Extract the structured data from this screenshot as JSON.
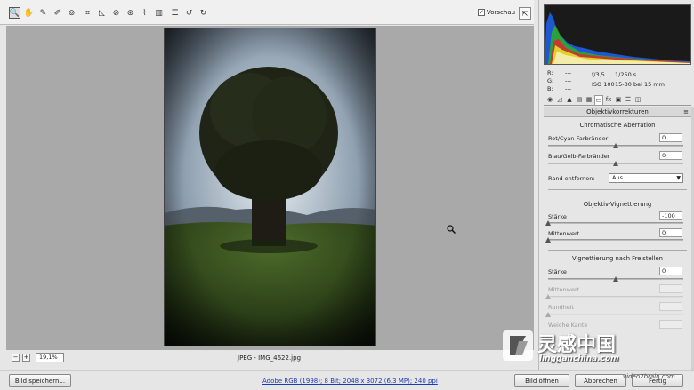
{
  "toolbar": {
    "tools": [
      {
        "name": "zoom-tool",
        "icon": "magnifier-icon",
        "glyph": "🔍"
      },
      {
        "name": "hand-tool",
        "icon": "hand-icon",
        "glyph": "✋"
      },
      {
        "name": "white-balance-tool",
        "icon": "eyedropper-icon",
        "glyph": "✎"
      },
      {
        "name": "color-sampler-tool",
        "icon": "eyedropper-plus-icon",
        "glyph": "✐"
      },
      {
        "name": "targeted-adjustment-tool",
        "icon": "target-icon",
        "glyph": "⊚"
      },
      {
        "name": "crop-tool",
        "icon": "crop-icon",
        "glyph": "⌗"
      },
      {
        "name": "straighten-tool",
        "icon": "straighten-icon",
        "glyph": "◺"
      },
      {
        "name": "spot-removal-tool",
        "icon": "spot-icon",
        "glyph": "⊘"
      },
      {
        "name": "red-eye-tool",
        "icon": "red-eye-icon",
        "glyph": "⊛"
      },
      {
        "name": "adjustment-brush-tool",
        "icon": "brush-icon",
        "glyph": "⌇"
      },
      {
        "name": "graduated-filter-tool",
        "icon": "gradient-icon",
        "glyph": "▥"
      },
      {
        "name": "preferences-button",
        "icon": "list-icon",
        "glyph": "☰"
      },
      {
        "name": "rotate-left-button",
        "icon": "rotate-left-icon",
        "glyph": "↺"
      },
      {
        "name": "rotate-right-button",
        "icon": "rotate-right-icon",
        "glyph": "↻"
      }
    ],
    "preview_label": "Vorschau",
    "preview_checked": true
  },
  "canvas": {
    "filename": "JPEG - IMG_4622.jpg",
    "zoom_level": "19,1%"
  },
  "footer": {
    "save_label": "Bild speichern...",
    "workflow_link": "Adobe RGB (1998); 8 Bit; 2048 x 3072 (6,3 MP); 240 ppi",
    "open_label": "Bild öffnen",
    "cancel_label": "Abbrechen",
    "done_label": "Fertig"
  },
  "camera_info": {
    "r_label": "R:",
    "r_value": "---",
    "g_label": "G:",
    "g_value": "---",
    "b_label": "B:",
    "b_value": "---",
    "aperture": "f/3,5",
    "shutter": "1/250 s",
    "iso": "ISO 100",
    "lens": "15-30 bei 15 mm"
  },
  "panel": {
    "title": "Objektivkorrekturen",
    "chromatic_title": "Chromatische Aberration",
    "red_cyan_label": "Rot/Cyan-Farbränder",
    "red_cyan_value": "0",
    "blue_yellow_label": "Blau/Gelb-Farbränder",
    "blue_yellow_value": "0",
    "defringe_label": "Rand entfernen:",
    "defringe_value": "Aus",
    "lens_vignette_title": "Objektiv-Vignettierung",
    "amount_label": "Stärke",
    "amount_value": "-100",
    "midpoint_label": "Mittenwert",
    "midpoint_value": "0",
    "post_crop_title": "Vignettierung nach Freistellen",
    "pc_amount_label": "Stärke",
    "pc_amount_value": "0",
    "pc_midpoint_label": "Mittenwert",
    "pc_roundness_label": "Rundheit",
    "pc_feather_label": "Weiche Kante"
  },
  "watermark": {
    "title": "灵感中国",
    "url": "lingganchina.com",
    "video_credit": "video2brain.com"
  },
  "colors": {
    "canvas_bg": "#a9a9a9",
    "link": "#1a3bb5"
  }
}
